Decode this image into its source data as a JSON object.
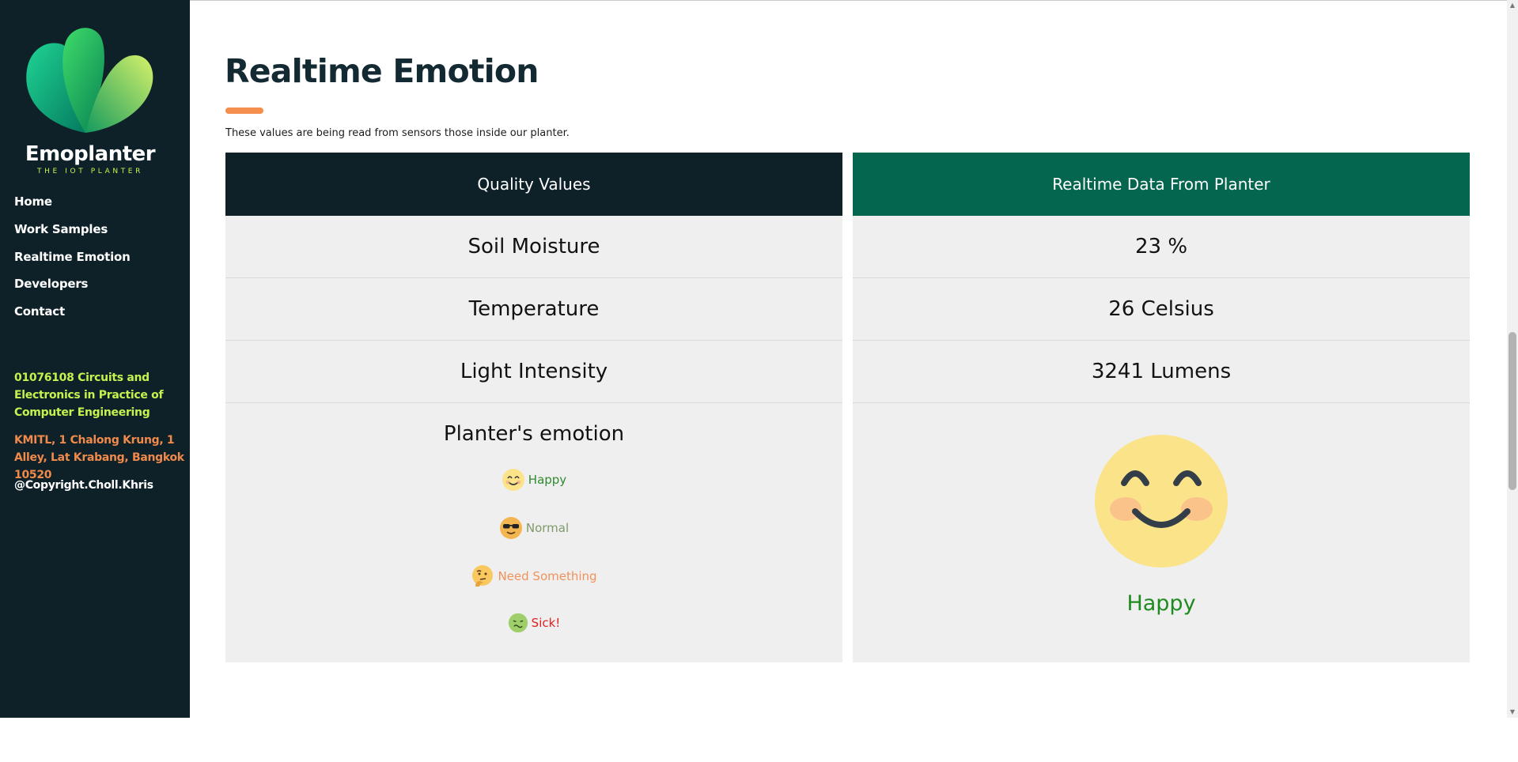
{
  "brand": {
    "name": "Emoplanter",
    "tagline": "THE IOT PLANTER",
    "colors": {
      "leaf_dark": "#0a8f6a",
      "leaf_light": "#b9ea56",
      "accent": "#c6f24e"
    }
  },
  "nav": {
    "items": [
      {
        "label": "Home"
      },
      {
        "label": "Work Samples"
      },
      {
        "label": "Realtime Emotion"
      },
      {
        "label": "Developers"
      },
      {
        "label": "Contact"
      }
    ]
  },
  "footer": {
    "course": "01076108 Circuits and Electronics in Practice of Computer Engineering",
    "address": "KMITL, 1 Chalong Krung, 1 Alley, Lat Krabang, Bangkok 10520",
    "copyright": "@Copyright.Choll.Khris"
  },
  "main": {
    "title": "Realtime Emotion",
    "subtitle": "These values are being read from sensors those inside our planter.",
    "left_column": {
      "header": "Quality Values",
      "rows": [
        "Soil Moisture",
        "Temperature",
        "Light Intensity"
      ],
      "emotion_title": "Planter's emotion",
      "legend": [
        {
          "emoji": "smiling-face-icon",
          "label": "Happy",
          "color": "#2f8a2f"
        },
        {
          "emoji": "sunglasses-face-icon",
          "label": "Normal",
          "color": "#7f9a6b"
        },
        {
          "emoji": "thinking-face-icon",
          "label": "Need Something",
          "color": "#f0925a"
        },
        {
          "emoji": "nauseated-face-icon",
          "label": "Sick!",
          "color": "#e02020"
        }
      ]
    },
    "right_column": {
      "header": "Realtime Data From Planter",
      "rows": [
        "23 %",
        "26 Celsius",
        "3241 Lumens"
      ],
      "emotion": "Happy",
      "emotion_icon": "smiling-face-icon"
    }
  }
}
